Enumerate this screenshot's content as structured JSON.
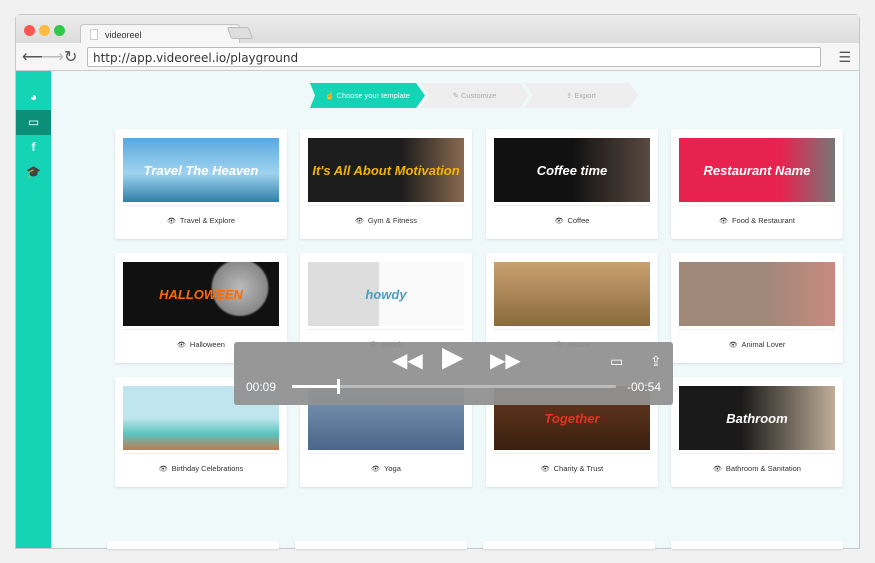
{
  "browser": {
    "tab_title": "videoreel",
    "url": "http://app.videoreel.io/playground",
    "traffic_colors": [
      "#fc5753",
      "#fdbc40",
      "#33c748"
    ]
  },
  "sidebar": {
    "items": [
      {
        "icon": "dashboard-icon",
        "glyph": "◕"
      },
      {
        "icon": "laptop-icon",
        "glyph": "▭",
        "active": true
      },
      {
        "icon": "facebook-icon",
        "glyph": "f"
      },
      {
        "icon": "graduation-cap-icon",
        "glyph": "🎓"
      }
    ],
    "color": "#14d4b5"
  },
  "steps": [
    {
      "label": "Choose your template",
      "icon": "☝",
      "active": true
    },
    {
      "label": "Customize",
      "icon": "✎"
    },
    {
      "label": "Export",
      "icon": "⇪"
    }
  ],
  "templates": [
    {
      "label": "Travel & Explore",
      "thumb_text": "Travel The Heaven",
      "bg": "linear-gradient(180deg,#5aa8e0,#9fd3ef 55%,#2f7fa8)"
    },
    {
      "label": "Gym & Fitness",
      "thumb_text": "It's All About Motivation",
      "bg": "linear-gradient(90deg,#1d1d1d 60%,#8a6a50)",
      "color": "#f5b400"
    },
    {
      "label": "Coffee",
      "thumb_text": "Coffee time",
      "bg": "linear-gradient(90deg,#111 50%,#5a4a40)"
    },
    {
      "label": "Food & Restaurant",
      "thumb_text": "Restaurant Name",
      "bg": "linear-gradient(90deg,#e8224f 65%,#777)"
    },
    {
      "label": "Halloween",
      "thumb_text": "HALLOWEEN",
      "bg": "radial-gradient(circle at 75% 40%,#bbb 0,#888 22%,#111 24%)",
      "color": "#ff6a00"
    },
    {
      "label": "Beach",
      "thumb_text": "howdy",
      "bg": "linear-gradient(90deg,#ddd 45%,#fafafa 46%)",
      "color": "#4a9ec0"
    },
    {
      "label": "Nature",
      "thumb_text": "",
      "bg": "linear-gradient(180deg,#c9a070,#8a6a3c)"
    },
    {
      "label": "Animal Lover",
      "thumb_text": "",
      "bg": "linear-gradient(90deg,#a08878 55%,#c88a80)"
    },
    {
      "label": "Birthday Celebrations",
      "thumb_text": "",
      "bg": "linear-gradient(180deg,#bfe6ee 50%,#5cc4c0 75%,#c07a50)"
    },
    {
      "label": "Yoga",
      "thumb_text": "",
      "bg": "linear-gradient(180deg,#8099b8,#4a6688)"
    },
    {
      "label": "Charity & Trust",
      "thumb_text": "Together",
      "bg": "linear-gradient(180deg,#6a3a20,#3a2010)",
      "color": "#e63020"
    },
    {
      "label": "Bathroom & Sanitation",
      "thumb_text": "Bathroom",
      "bg": "linear-gradient(90deg,#1a1a1a 40%,#bfae98)"
    }
  ],
  "player": {
    "current_time": "00:09",
    "remaining_time": "-00:54",
    "progress": 0.14
  }
}
